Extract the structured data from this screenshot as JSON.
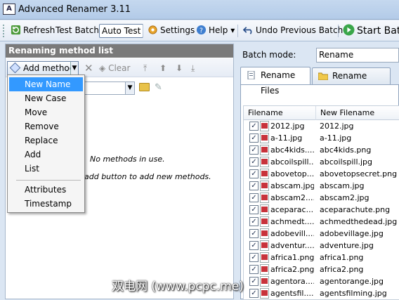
{
  "window": {
    "title": "Advanced Renamer 3.11",
    "app_icon": "renamer-logo-icon"
  },
  "toolbar": {
    "refresh": "Refresh",
    "test_batch": "Test Batch",
    "auto_test": "Auto Test",
    "settings": "Settings",
    "help": "Help",
    "help_arrow": "▾",
    "undo": "Undo Previous Batch",
    "start": "Start Batch"
  },
  "left_panel": {
    "header": "Renaming method list",
    "add_method": "Add method",
    "clear": "Clear",
    "empty_message": "No methods in use.",
    "hint_message": "add button to add new methods."
  },
  "add_menu": {
    "items": [
      "New Name",
      "New Case",
      "Move",
      "Remove",
      "Replace",
      "Add",
      "List"
    ],
    "items2": [
      "Attributes",
      "Timestamp"
    ],
    "highlighted": "New Name"
  },
  "right_panel": {
    "batch_mode_label": "Batch mode:",
    "batch_mode_value": "Rename",
    "tabs": [
      "Rename Files",
      "Rename Folders"
    ],
    "columns": [
      "Filename",
      "New Filename"
    ],
    "files": [
      {
        "filename": "2012.jpg",
        "new": "2012.jpg"
      },
      {
        "filename": "a-11.jpg",
        "new": "a-11.jpg"
      },
      {
        "filename": "abc4kids....",
        "new": "abc4kids.png"
      },
      {
        "filename": "abcoilspill....",
        "new": "abcoilspill.jpg"
      },
      {
        "filename": "abovetop....",
        "new": "abovetopsecret.png"
      },
      {
        "filename": "abscam.jpg",
        "new": "abscam.jpg"
      },
      {
        "filename": "abscam2....",
        "new": "abscam2.jpg"
      },
      {
        "filename": "aceparac....",
        "new": "aceparachute.png"
      },
      {
        "filename": "achmedt....",
        "new": "achmedthedead.jpg"
      },
      {
        "filename": "adobevill....",
        "new": "adobevillage.jpg"
      },
      {
        "filename": "adventur....",
        "new": "adventure.jpg"
      },
      {
        "filename": "africa1.png",
        "new": "africa1.png"
      },
      {
        "filename": "africa2.png",
        "new": "africa2.png"
      },
      {
        "filename": "agentora....",
        "new": "agentorange.jpg"
      },
      {
        "filename": "agentsfil....",
        "new": "agentsfilming.jpg"
      }
    ]
  },
  "watermark": "双电网 (www.pcpc.me)",
  "colors": {
    "highlight": "#3399ff",
    "header_gray": "#7a7a7a",
    "window_bg": "#dbe6f3"
  }
}
